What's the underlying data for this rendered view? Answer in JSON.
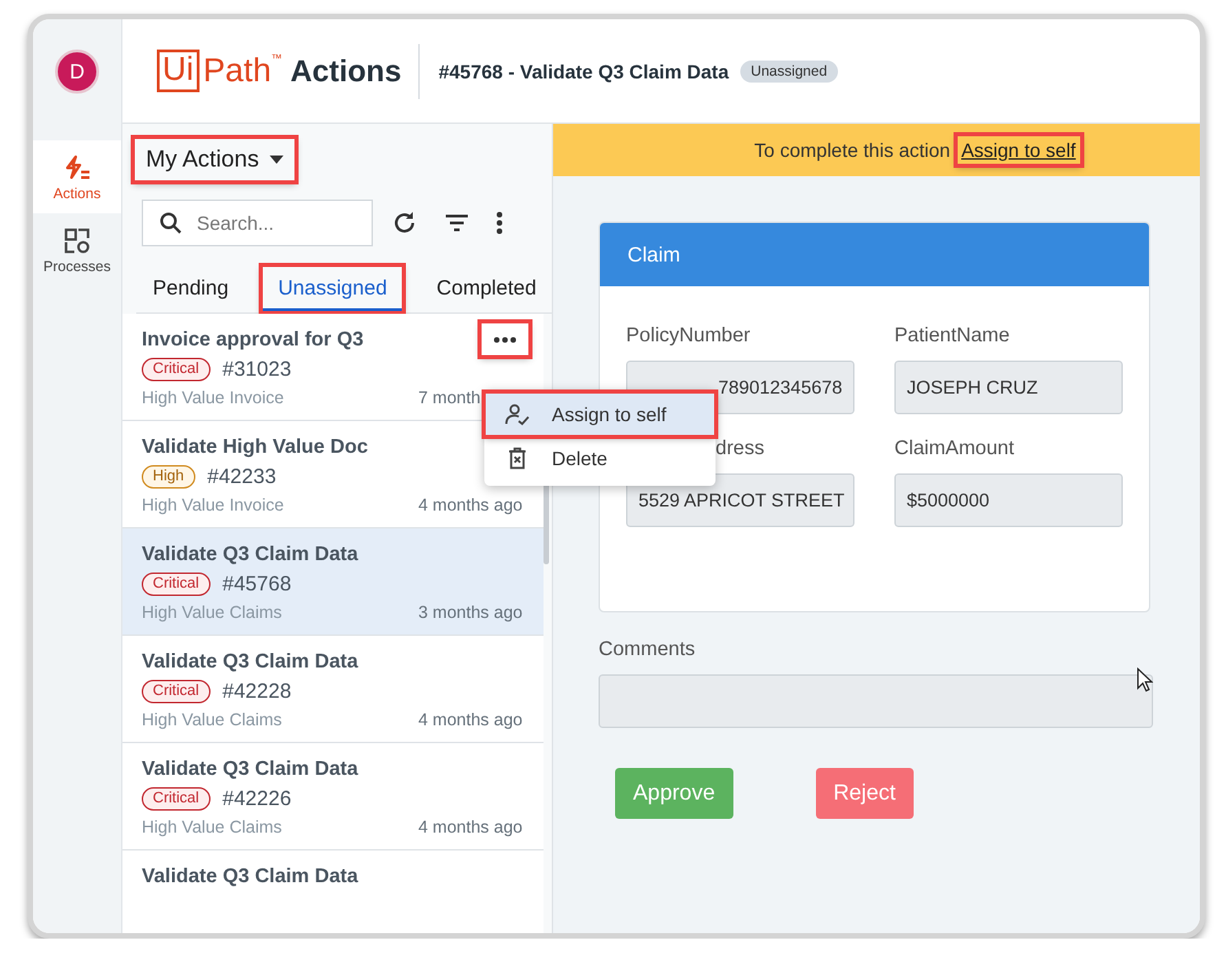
{
  "rail": {
    "avatar": "D",
    "items": [
      {
        "label": "Actions",
        "selected": true
      },
      {
        "label": "Processes",
        "selected": false
      }
    ]
  },
  "header": {
    "logo": {
      "boxed": "Ui",
      "rest": "Path",
      "mark": "™",
      "product": "Actions"
    },
    "title": "#45768 - Validate Q3 Claim Data",
    "status": "Unassigned"
  },
  "list_panel": {
    "view": {
      "label": "My Actions",
      "highlighted": true
    },
    "search": {
      "placeholder": "Search..."
    },
    "tabs": [
      {
        "label": "Pending",
        "selected": false,
        "highlighted": false
      },
      {
        "label": "Unassigned",
        "selected": true,
        "highlighted": true
      },
      {
        "label": "Completed",
        "selected": false,
        "highlighted": false
      }
    ],
    "tasks": [
      {
        "title": "Invoice approval for Q3",
        "priority": "Critical",
        "kind": "critical",
        "number": "#31023",
        "category": "High Value Invoice",
        "time": "7 month",
        "selected": false,
        "more_button": true
      },
      {
        "title": "Validate High Value Doc",
        "priority": "High",
        "kind": "high",
        "number": "#42233",
        "category": "High Value Invoice",
        "time": "4 months ago",
        "selected": false,
        "more_button": false
      },
      {
        "title": "Validate Q3 Claim Data",
        "priority": "Critical",
        "kind": "critical",
        "number": "#45768",
        "category": "High Value Claims",
        "time": "3 months ago",
        "selected": true,
        "more_button": false
      },
      {
        "title": "Validate Q3 Claim Data",
        "priority": "Critical",
        "kind": "critical",
        "number": "#42228",
        "category": "High Value Claims",
        "time": "4 months ago",
        "selected": false,
        "more_button": false
      },
      {
        "title": "Validate Q3 Claim Data",
        "priority": "Critical",
        "kind": "critical",
        "number": "#42226",
        "category": "High Value Claims",
        "time": "4 months ago",
        "selected": false,
        "more_button": false
      },
      {
        "title": "Validate Q3 Claim Data",
        "selected": false,
        "more_button": false
      }
    ]
  },
  "context_menu": {
    "items": [
      {
        "label": "Assign to self",
        "selected": true,
        "highlighted": true
      },
      {
        "label": "Delete",
        "selected": false,
        "highlighted": false
      }
    ]
  },
  "banner": {
    "text": "To complete this action",
    "link": "Assign to self",
    "highlighted": true
  },
  "form": {
    "title": "Claim",
    "fields": [
      {
        "label": "PolicyNumber",
        "value": "789012345678"
      },
      {
        "label": "PatientName",
        "value": "JOSEPH CRUZ"
      },
      {
        "label": "dress",
        "value": "5529 APRICOT STREET"
      },
      {
        "label": "ClaimAmount",
        "value": "$5000000"
      }
    ],
    "comments": {
      "label": "Comments"
    },
    "buttons": [
      {
        "label": "Approve",
        "kind": "approve"
      },
      {
        "label": "Reject",
        "kind": "reject"
      }
    ]
  }
}
